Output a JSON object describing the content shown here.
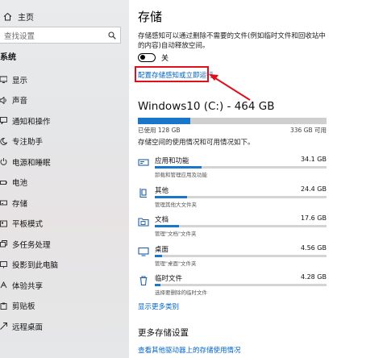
{
  "sidebar": {
    "home_label": "主页",
    "search_placeholder": "查找设置",
    "section_title": "系统",
    "items": [
      {
        "label": "显示",
        "icon": "display-icon"
      },
      {
        "label": "声音",
        "icon": "speaker-icon"
      },
      {
        "label": "通知和操作",
        "icon": "notification-icon"
      },
      {
        "label": "专注助手",
        "icon": "moon-icon"
      },
      {
        "label": "电源和睡眠",
        "icon": "power-icon"
      },
      {
        "label": "电池",
        "icon": "battery-icon"
      },
      {
        "label": "存储",
        "icon": "storage-icon"
      },
      {
        "label": "平板模式",
        "icon": "tablet-icon"
      },
      {
        "label": "多任务处理",
        "icon": "multitask-icon"
      },
      {
        "label": "投影到此电脑",
        "icon": "project-icon"
      },
      {
        "label": "体验共享",
        "icon": "share-icon"
      },
      {
        "label": "剪贴板",
        "icon": "clipboard-icon"
      },
      {
        "label": "远程桌面",
        "icon": "remote-desktop-icon"
      }
    ]
  },
  "main": {
    "title": "存储",
    "description": "存储感知可以通过删除不需要的文件(例如临时文件和回收站中的内容)自动释放空间。",
    "toggle": {
      "state": "关",
      "on": false
    },
    "configure_link": "配置存储感知或立即运行",
    "drive": {
      "title": "Windows10 (C:) - 464 GB",
      "used_label": "已使用 128 GB",
      "available_label": "336 GB 可用",
      "used_fraction": 0.276
    },
    "usage_description": "存储空间的使用情况和可用情况如下。",
    "categories": [
      {
        "name": "应用和功能",
        "size": "34.1 GB",
        "sub": "卸载和管理应用及功能",
        "icon": "apps-icon",
        "fraction": 0.27
      },
      {
        "name": "其他",
        "size": "24.4 GB",
        "sub": "管理其他大文件夹",
        "icon": "other-files-icon",
        "fraction": 0.19
      },
      {
        "name": "文档",
        "size": "17.6 GB",
        "sub": "管理\"文档\"文件夹",
        "icon": "documents-icon",
        "fraction": 0.14
      },
      {
        "name": "桌面",
        "size": "4.56 GB",
        "sub": "管理\"桌面\"文件夹",
        "icon": "desktop-icon",
        "fraction": 0.04
      },
      {
        "name": "临时文件",
        "size": "4.28 GB",
        "sub": "选择要删除的临时文件",
        "icon": "trash-icon",
        "fraction": 0.035
      }
    ],
    "show_more_link": "显示更多类别",
    "more_settings_title": "更多存储设置",
    "other_drives_link": "查看其他驱动器上的存储使用情况"
  },
  "colors": {
    "accent": "#1976c8",
    "link": "#0064c8",
    "highlight": "#e0101a"
  }
}
